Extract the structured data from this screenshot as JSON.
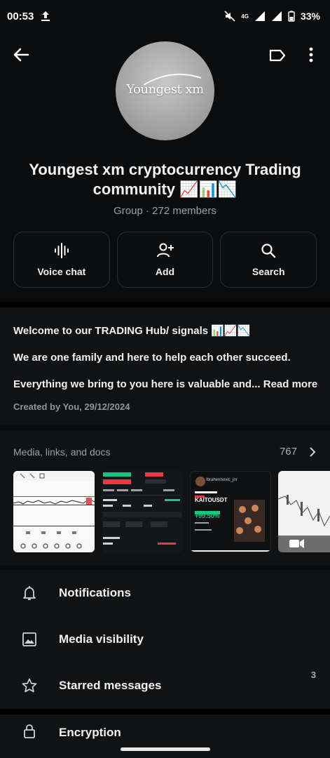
{
  "status_bar": {
    "time": "00:53",
    "battery": "33%",
    "network": "4G"
  },
  "header": {
    "avatar_text": "Youngest xm",
    "title": "Youngest xm cryptocurrency Trading community 📈📊📉",
    "subtitle": "Group · 272 members"
  },
  "actions": [
    {
      "label": "Voice chat",
      "icon": "voice-wave-icon"
    },
    {
      "label": "Add",
      "icon": "add-person-icon"
    },
    {
      "label": "Search",
      "icon": "search-icon"
    }
  ],
  "description": {
    "line1": "Welcome to our TRADING Hub/ signals 📊📈📉",
    "line2": "We are one family and here to help each other succeed.",
    "line3": "Everything we bring to you here is valuable and... Read more",
    "created": "Created by You, 29/12/2024"
  },
  "media": {
    "heading": "Media, links, and docs",
    "count": "767",
    "thumb3": {
      "user": "Ibrahermovic_jnr",
      "pair": "KAITOUSDT",
      "gain": "+99.50%"
    }
  },
  "settings": [
    {
      "label": "Notifications",
      "icon": "bell-icon",
      "badge": ""
    },
    {
      "label": "Media visibility",
      "icon": "image-icon",
      "badge": ""
    },
    {
      "label": "Starred messages",
      "icon": "star-icon",
      "badge": "3"
    }
  ],
  "encryption": {
    "label": "Encryption"
  },
  "colors": {
    "background": "#0b0c0e",
    "panel": "#111214",
    "text": "#e9edef",
    "muted": "#9aa0a6",
    "accent_green": "#16c784",
    "accent_red": "#ea3943"
  }
}
